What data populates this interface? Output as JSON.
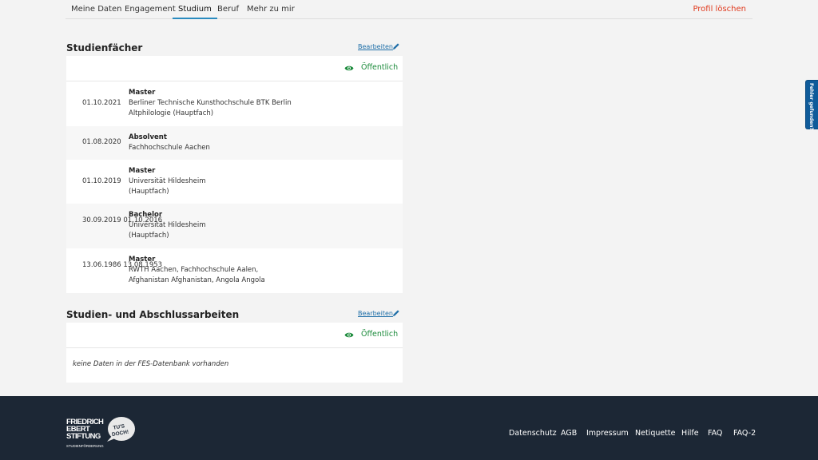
{
  "nav": {
    "tabs": [
      "Meine Daten",
      "Engagement",
      "Studium",
      "Beruf",
      "Mehr zu mir"
    ],
    "active_tab": "Studium",
    "delete_profile": "Profil löschen"
  },
  "studienfaecher": {
    "title": "Studienfächer",
    "edit_label": "Bearbeiten",
    "visibility": "Öffentlich",
    "entries": [
      {
        "dates": [
          "01.10.2021"
        ],
        "degree": "Master",
        "lines": [
          "Berliner Technische Kunsthochschule BTK Berlin",
          "Altphilologie (Hauptfach)"
        ]
      },
      {
        "dates": [
          "01.08.2020"
        ],
        "degree": "Absolvent",
        "lines": [
          "Fachhochschule Aachen"
        ]
      },
      {
        "dates": [
          "01.10.2019"
        ],
        "degree": "Master",
        "lines": [
          "Universität Hildesheim",
          "(Hauptfach)"
        ]
      },
      {
        "dates": [
          "30.09.2019",
          "01.10.2016"
        ],
        "degree": "Bachelor",
        "lines": [
          "Universität Hildesheim",
          "(Hauptfach)"
        ]
      },
      {
        "dates": [
          "13.06.1986",
          "13.08.1953"
        ],
        "degree": "Master",
        "lines": [
          "RWTH Aachen, Fachhochschule Aalen,",
          "Afghanistan Afghanistan, Angola Angola"
        ]
      }
    ]
  },
  "abschlussarbeiten": {
    "title": "Studien- und Abschlussarbeiten",
    "edit_label": "Bearbeiten",
    "visibility": "Öffentlich",
    "empty_text": "keine Daten in der FES-Datenbank vorhanden"
  },
  "feedback_tab": "Fehler gefunden?",
  "footer": {
    "logo_text": [
      "FRIEDRICH",
      "EBERT",
      "STIFTUNG",
      "TU'S",
      "DOCH!",
      "STUDIENFÖRDERUNG"
    ],
    "links": [
      "Datenschutz",
      "AGB",
      "Impressum",
      "Netiquette",
      "Hilfe",
      "FAQ",
      "FAQ-2"
    ]
  },
  "colors": {
    "accent": "#2a8bbf",
    "public_green": "#1a8a3a",
    "danger": "#e03a1e",
    "footer_bg": "#1c2735",
    "link_blue": "#1f6fa8"
  }
}
